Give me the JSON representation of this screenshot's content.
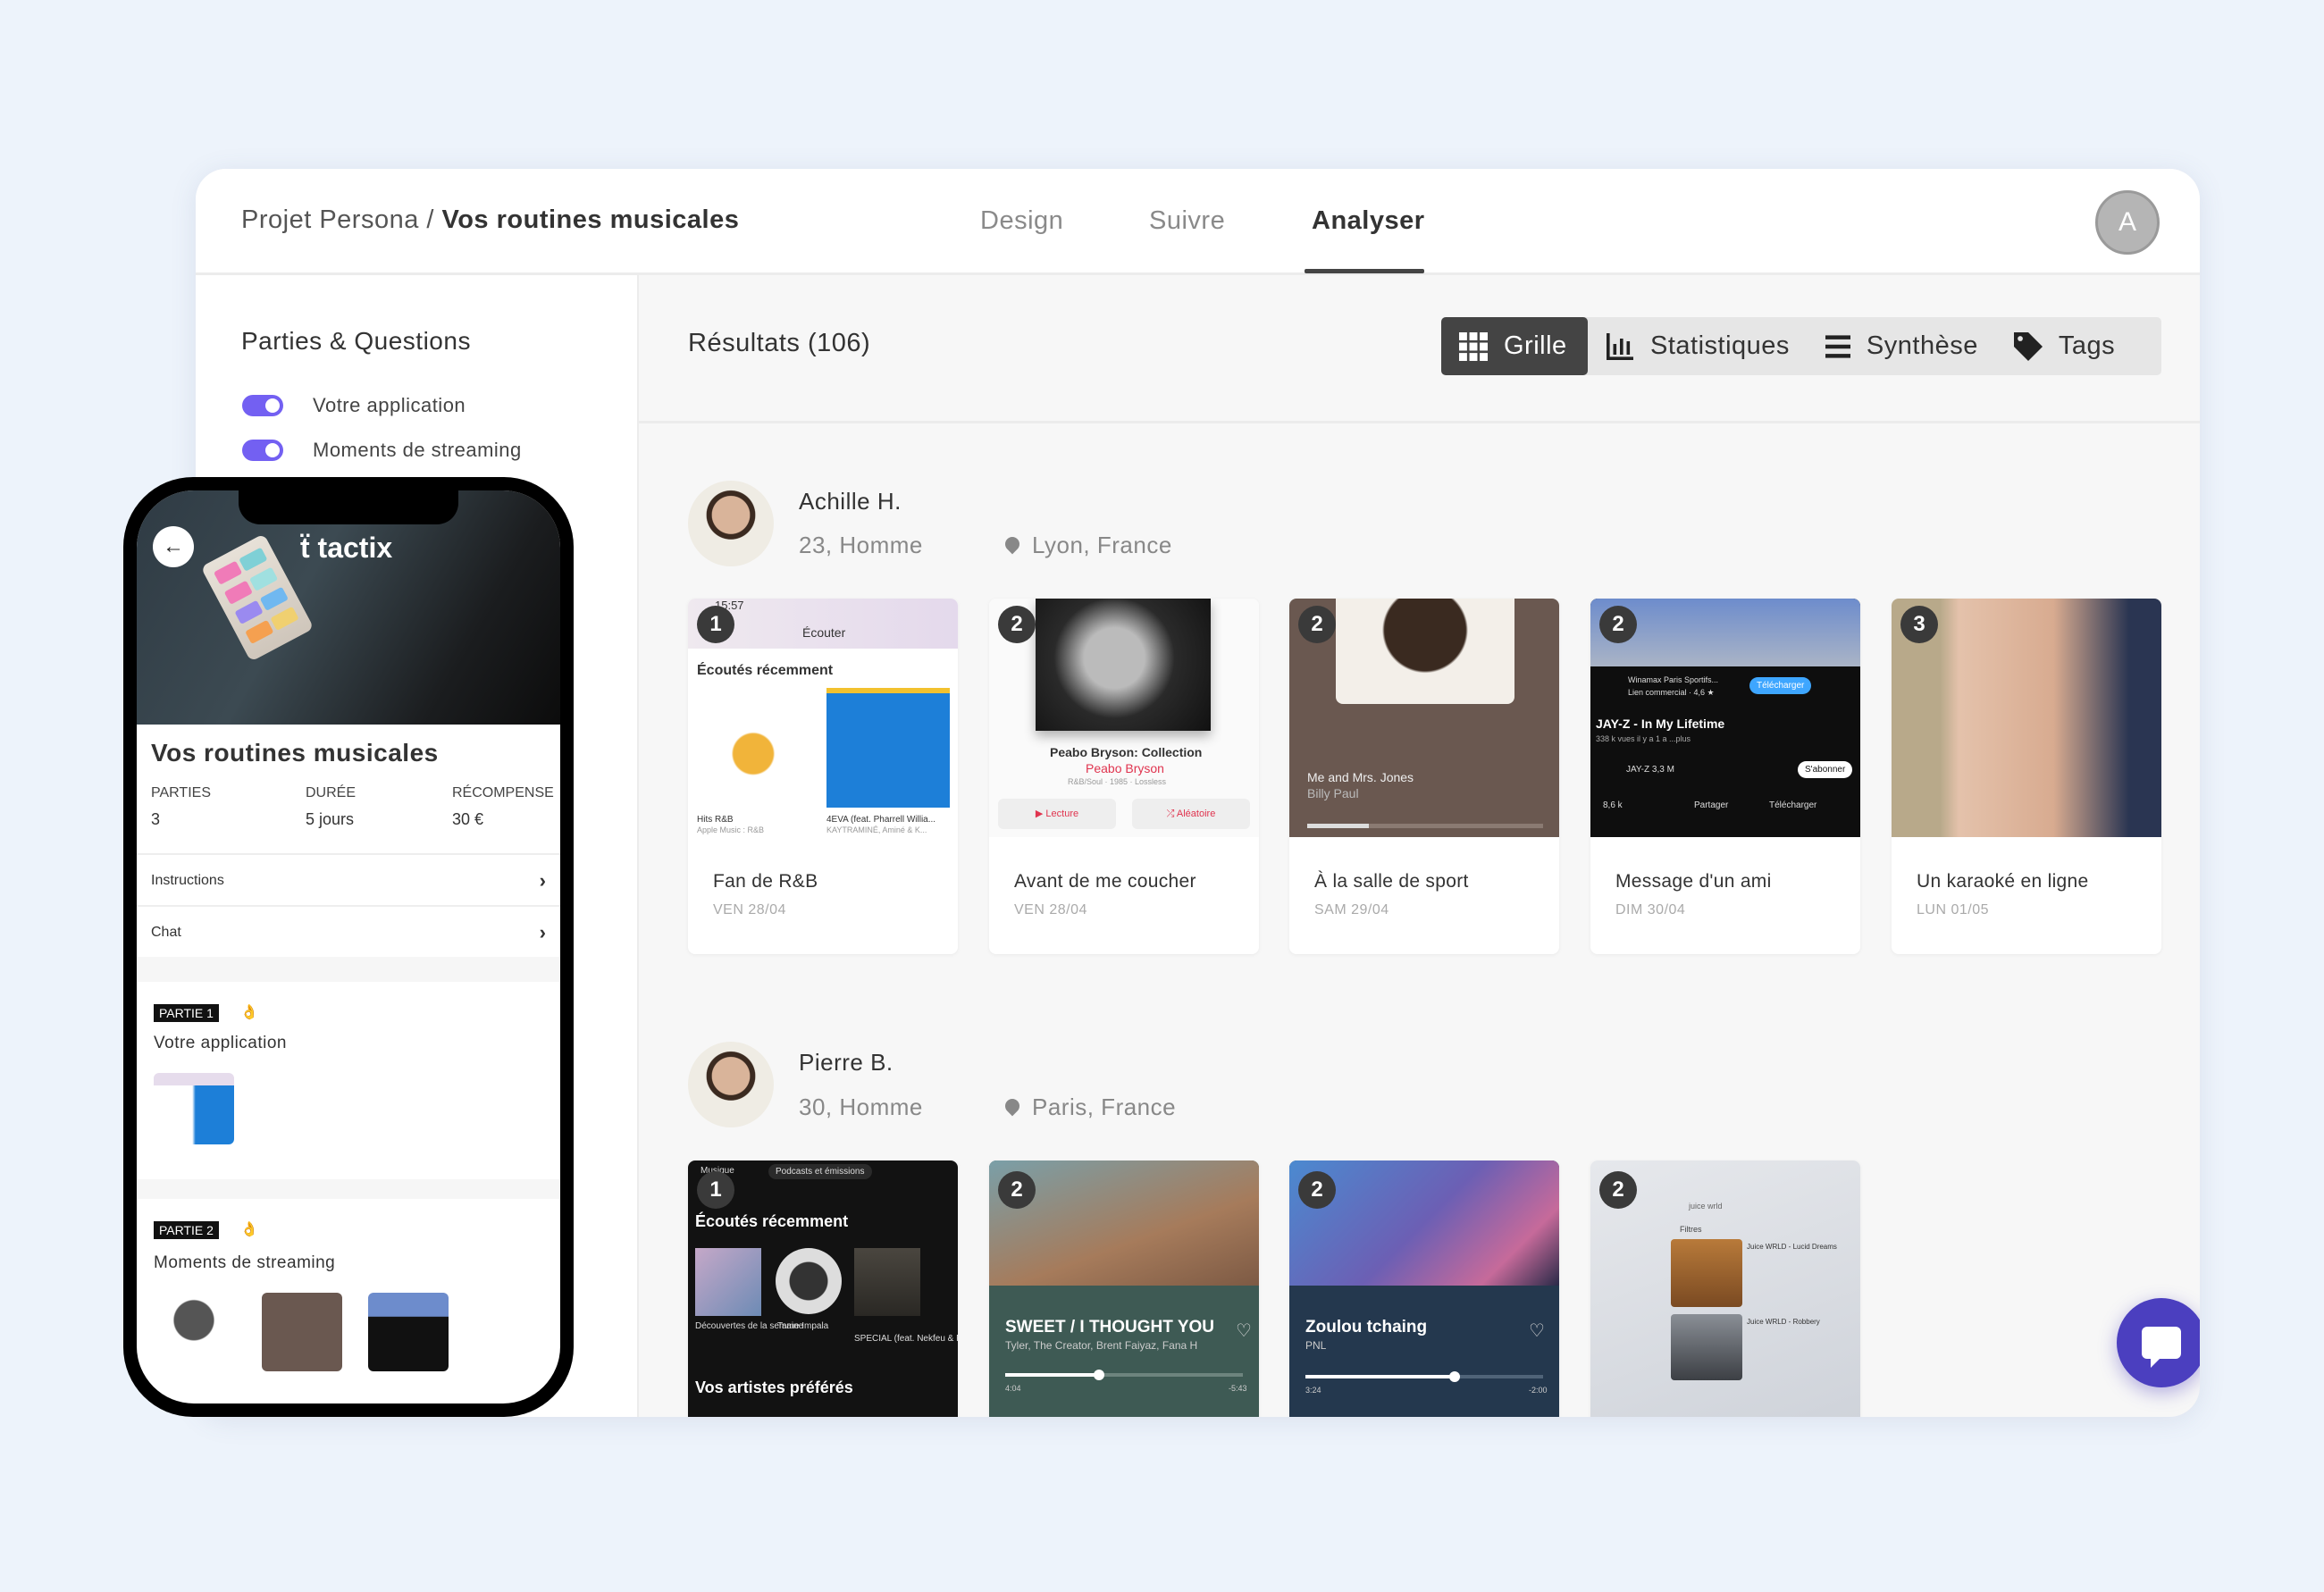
{
  "header": {
    "breadcrumb_project": "Projet Persona /",
    "breadcrumb_current": "Vos routines musicales",
    "tabs": [
      {
        "label": "Design"
      },
      {
        "label": "Suivre"
      },
      {
        "label": "Analyser",
        "active": true
      }
    ],
    "avatar_initial": "A"
  },
  "sidebar": {
    "title": "Parties & Questions",
    "items": [
      {
        "label": "Votre application",
        "enabled": true
      },
      {
        "label": "Moments de streaming",
        "enabled": true
      }
    ]
  },
  "main": {
    "results_title": "Résultats (106)",
    "views": [
      {
        "label": "Grille",
        "icon": "grid-icon",
        "active": true
      },
      {
        "label": "Statistiques",
        "icon": "bar-chart-icon"
      },
      {
        "label": "Synthèse",
        "icon": "list-icon"
      },
      {
        "label": "Tags",
        "icon": "tag-icon"
      }
    ],
    "participants": [
      {
        "name": "Achille H.",
        "age_gender": "23, Homme",
        "location": "Lyon, France",
        "cards": [
          {
            "step": "1",
            "title": "Fan de R&B",
            "date": "VEN 28/04",
            "shot": {
              "time": "15:57",
              "header": "Écouter",
              "section": "Écoutés récemment",
              "item1": "Hits R&B",
              "item1_sub": "Apple Music : R&B",
              "item2": "4EVA (feat. Pharrell Willia...",
              "item2_sub": "KAYTRAMINÉ, Aminé & K..."
            }
          },
          {
            "step": "2",
            "title": "Avant de me coucher",
            "date": "VEN 28/04",
            "shot": {
              "album": "Peabo Bryson: Collection",
              "artist": "Peabo Bryson",
              "meta": "R&B/Soul · 1985 · Lossless",
              "play": "▶ Lecture",
              "shuffle": "⤮ Aléatoire"
            }
          },
          {
            "step": "2",
            "title": "À la salle de sport",
            "date": "SAM 29/04",
            "shot": {
              "track": "Me and Mrs. Jones",
              "artist": "Billy Paul"
            }
          },
          {
            "step": "2",
            "title": "Message d'un ami",
            "date": "DIM 30/04",
            "shot": {
              "ad": "Winamax Paris Sportifs...",
              "ad_sub": "Lien commercial · 4,6 ★",
              "download": "Télécharger",
              "video": "JAY-Z - In My Lifetime",
              "views": "338 k vues  il y a 1 a  ...plus",
              "channel": "JAY-Z  3,3 M",
              "subscribe": "S'abonner",
              "likes": "8,6 k",
              "share": "Partager",
              "dl": "Télécharger"
            }
          },
          {
            "step": "3",
            "title": "Un karaoké en ligne",
            "date": "LUN 01/05",
            "shot": {}
          }
        ]
      },
      {
        "name": "Pierre B.",
        "age_gender": "30, Homme",
        "location": "Paris, France",
        "cards": [
          {
            "step": "1",
            "shot": {
              "chip1": "Musique",
              "chip2": "Podcasts et émissions",
              "section": "Écoutés récemment",
              "item1": "Découvertes de la semaine",
              "item2": "Tame Impala",
              "item3": "SPECIAL (feat. Nekfeu & Fo...",
              "section2": "Vos artistes préférés"
            }
          },
          {
            "step": "2",
            "shot": {
              "track": "SWEET / I THOUGHT YOU",
              "artist": "Tyler, The Creator, Brent Faiyaz, Fana H",
              "elapsed": "4:04",
              "remaining": "-5:43",
              "progress": 0.4
            }
          },
          {
            "step": "2",
            "shot": {
              "track": "Zoulou tchaing",
              "artist": "PNL",
              "elapsed": "3:24",
              "remaining": "-2:00",
              "progress": 0.63
            }
          },
          {
            "step": "2",
            "shot": {
              "search": "juice wrld",
              "filters": "Filtres",
              "result1": "Juice WRLD - Lucid Dreams",
              "result2": "Juice WRLD - Robbery"
            }
          }
        ]
      }
    ]
  },
  "phone": {
    "logo": "tactix",
    "title": "Vos routines musicales",
    "stats": [
      {
        "label": "PARTIES",
        "value": "3"
      },
      {
        "label": "DURÉE",
        "value": "5 jours"
      },
      {
        "label": "RÉCOMPENSE",
        "value": "30 €"
      }
    ],
    "rows": [
      {
        "label": "Instructions"
      },
      {
        "label": "Chat"
      }
    ],
    "parts": [
      {
        "badge": "PARTIE 1",
        "emoji": "👌",
        "title": "Votre application"
      },
      {
        "badge": "PARTIE 2",
        "emoji": "👌",
        "title": "Moments de streaming"
      }
    ]
  },
  "colors": {
    "accent": "#7360f2",
    "chat_button": "#4b3fbf",
    "active_view": "#444444",
    "background": "#edf3fb"
  }
}
